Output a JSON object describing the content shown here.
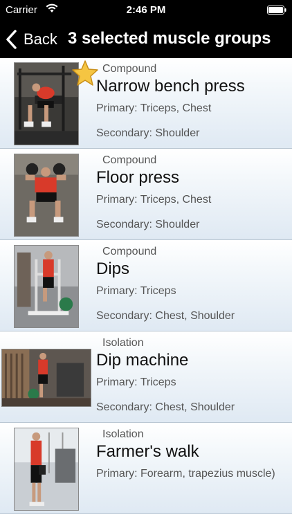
{
  "status": {
    "carrier": "Carrier",
    "time": "2:46 PM"
  },
  "nav": {
    "back_label": "Back",
    "title": "3 selected muscle groups"
  },
  "exercises": [
    {
      "type": "Compound",
      "name": "Narrow bench press",
      "primary": "Primary: Triceps, Chest",
      "secondary": "Secondary: Shoulder",
      "favorite": true
    },
    {
      "type": "Compound",
      "name": "Floor press",
      "primary": "Primary: Triceps, Chest",
      "secondary": "Secondary: Shoulder",
      "favorite": false
    },
    {
      "type": "Compound",
      "name": "Dips",
      "primary": "Primary: Triceps",
      "secondary": "Secondary: Chest, Shoulder",
      "favorite": false
    },
    {
      "type": "Isolation",
      "name": "Dip machine",
      "primary": "Primary: Triceps",
      "secondary": "Secondary: Chest, Shoulder",
      "favorite": false
    },
    {
      "type": "Isolation",
      "name": "Farmer's walk",
      "primary": "Primary: Forearm, trapezius muscle)",
      "secondary": "",
      "favorite": false
    }
  ],
  "colors": {
    "nav_background": "#000000",
    "row_gradient_bottom": "#dfe9f3",
    "star": "#f5c542"
  }
}
